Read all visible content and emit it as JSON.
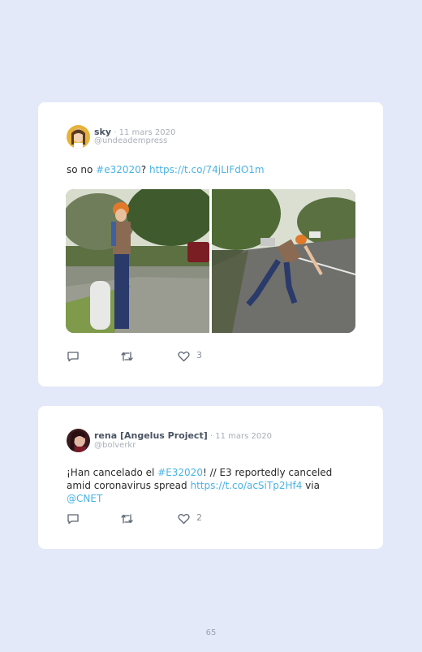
{
  "tweets": [
    {
      "author": "sky",
      "separator": " · ",
      "date": "11 mars 2020",
      "handle": "@undeadempress",
      "text_before": "so no ",
      "hashtag": "#e32020",
      "text_mid": "? ",
      "link": "https://t.co/74jLIFdO1m",
      "likes": "3"
    },
    {
      "author": "rena [Angelus Project]",
      "separator": " · ",
      "date": "11 mars 2020",
      "handle": "@bolverkr",
      "text_before": "¡Han cancelado el ",
      "hashtag": "#E32020",
      "text_mid": "! // E3 reportedly canceled amid coronavirus spread ",
      "link": "https://t.co/acSiTp2Hf4",
      "text_after": " via ",
      "mention": "@CNET",
      "likes": "2"
    }
  ],
  "page_number": "65",
  "icons": [
    "reply-icon",
    "retweet-icon",
    "heart-icon"
  ],
  "colors": {
    "background": "#e3e9f8",
    "link": "#4ab3e6"
  }
}
